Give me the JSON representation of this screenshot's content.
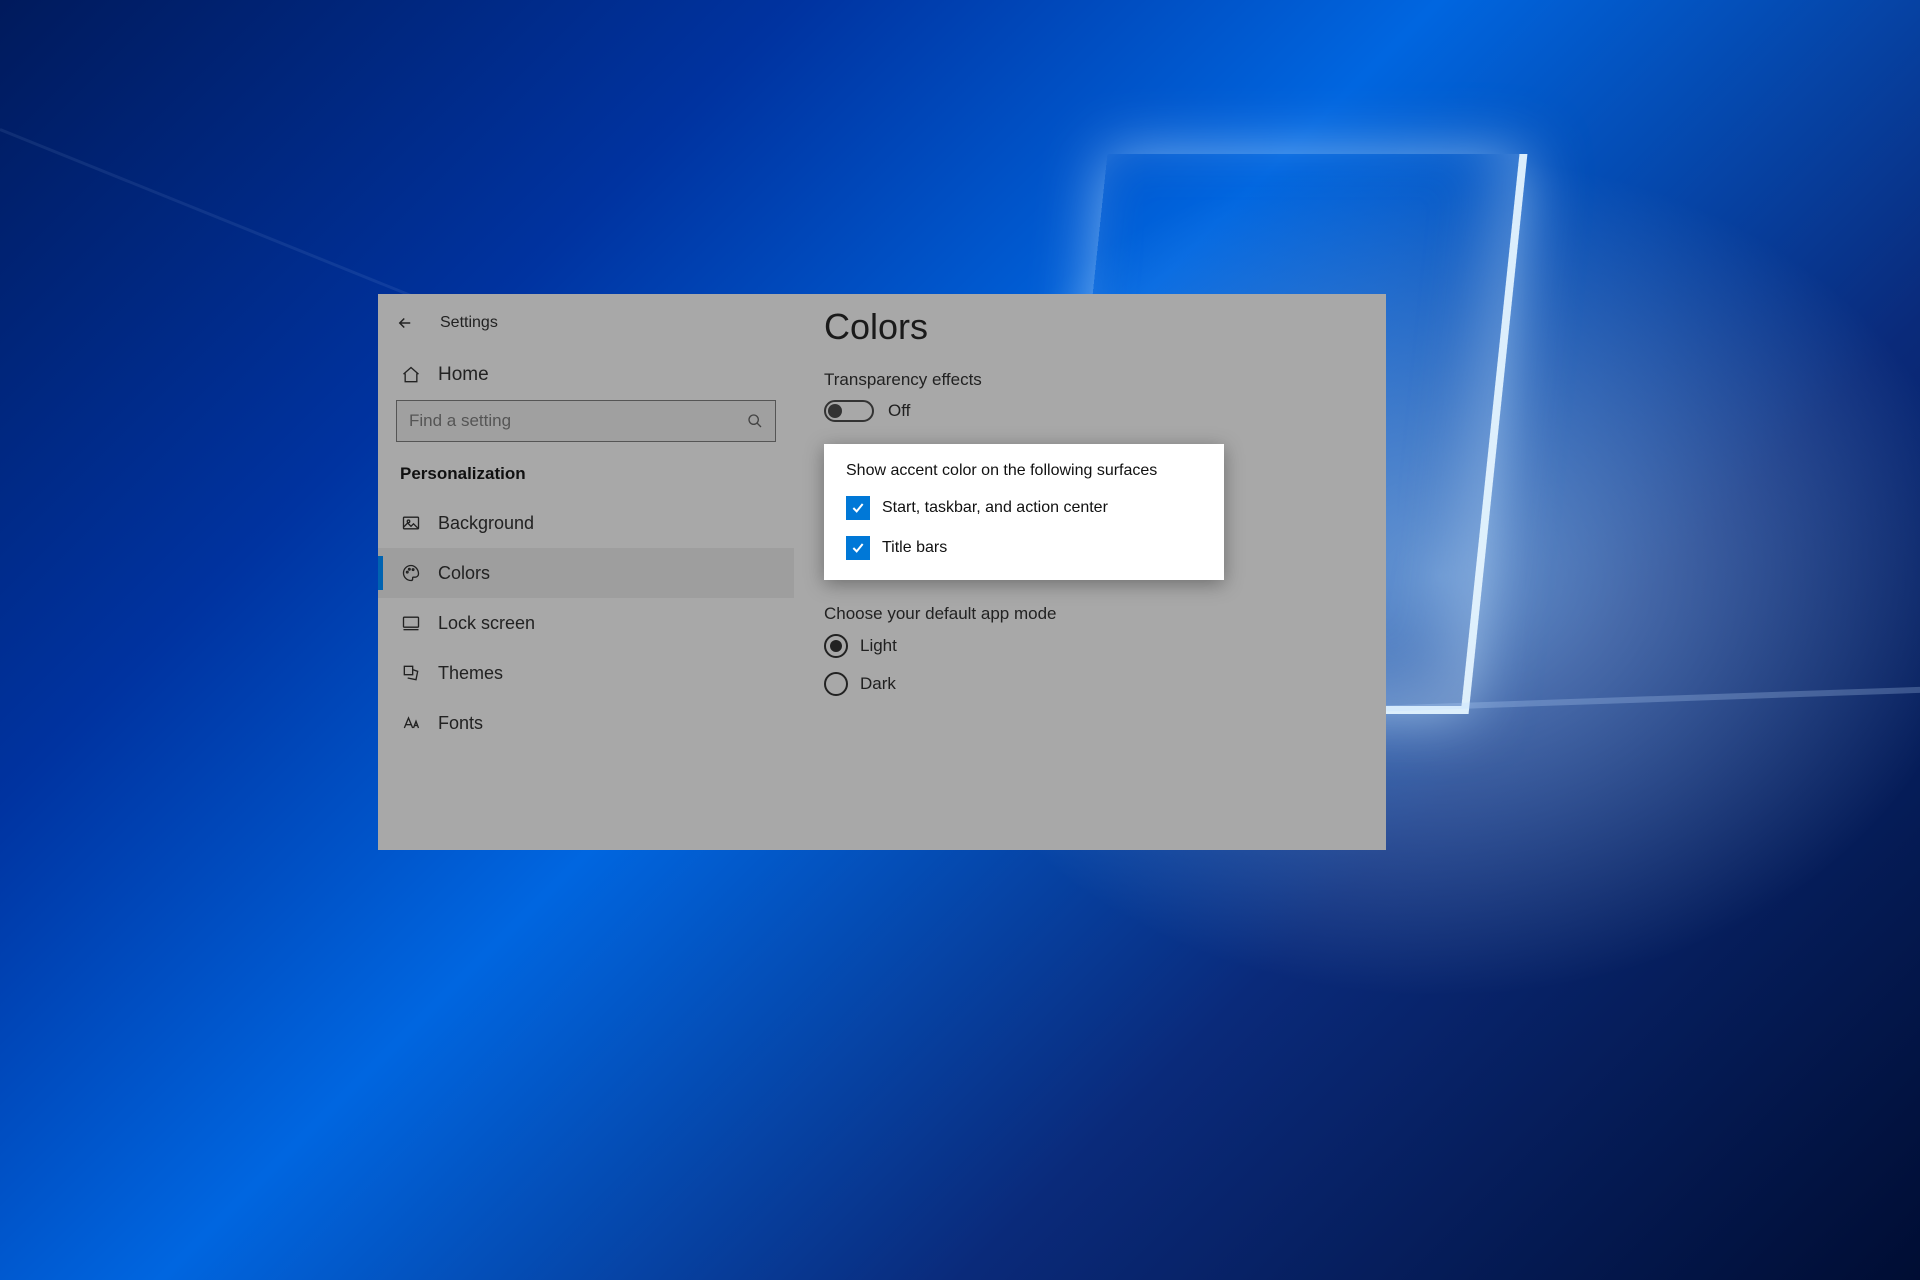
{
  "colors": {
    "accent": "#0078d7"
  },
  "window": {
    "title": "Settings"
  },
  "sidebar": {
    "home": "Home",
    "search_placeholder": "Find a setting",
    "section": "Personalization",
    "items": [
      {
        "label": "Background"
      },
      {
        "label": "Colors"
      },
      {
        "label": "Lock screen"
      },
      {
        "label": "Themes"
      },
      {
        "label": "Fonts"
      }
    ]
  },
  "content": {
    "title": "Colors",
    "transparency": {
      "label": "Transparency effects",
      "state": "Off"
    },
    "accent_surfaces": {
      "label": "Show accent color on the following surfaces",
      "options": [
        "Start, taskbar, and action center",
        "Title bars"
      ]
    },
    "app_mode": {
      "label": "Choose your default app mode",
      "options": [
        "Light",
        "Dark"
      ]
    }
  }
}
